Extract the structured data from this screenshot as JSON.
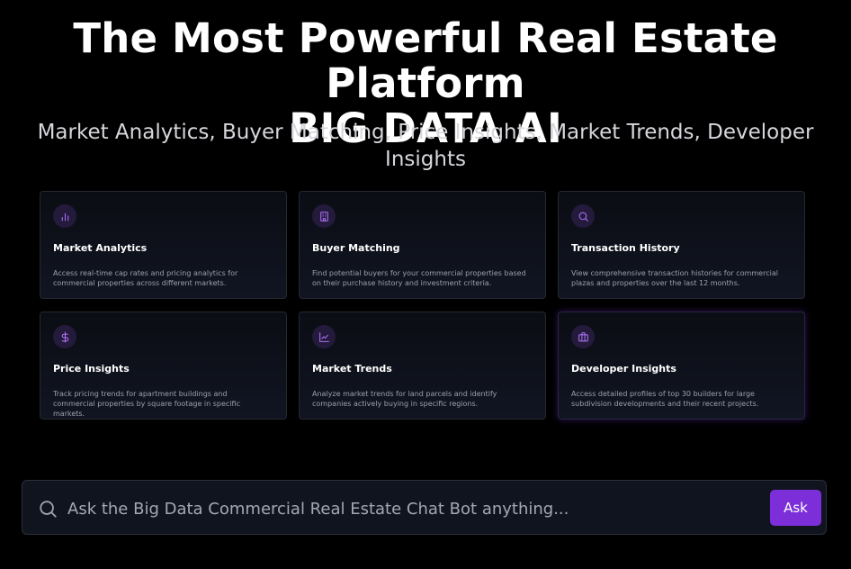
{
  "hero": {
    "title_line1": "The Most Powerful Real Estate Platform",
    "title_line2": "BIG DATA AI",
    "subtitle": "Market Analytics, Buyer Matching, Price Insights, Market Trends, Developer Insights"
  },
  "colors": {
    "accent": "#7c2fd9",
    "icon_bg": "#241a3b",
    "icon_stroke": "#a970f0"
  },
  "cards": [
    {
      "icon": "bar-chart-icon",
      "title": "Market Analytics",
      "desc": "Access real-time cap rates and pricing analytics for commercial properties across different markets."
    },
    {
      "icon": "building-icon",
      "title": "Buyer Matching",
      "desc": "Find potential buyers for your commercial properties based on their purchase history and investment criteria."
    },
    {
      "icon": "search-icon",
      "title": "Transaction History",
      "desc": "View comprehensive transaction histories for commercial plazas and properties over the last 12 months."
    },
    {
      "icon": "dollar-icon",
      "title": "Price Insights",
      "desc": "Track pricing trends for apartment buildings and commercial properties by square footage in specific markets."
    },
    {
      "icon": "line-chart-icon",
      "title": "Market Trends",
      "desc": "Analyze market trends for land parcels and identify companies actively buying in specific regions."
    },
    {
      "icon": "briefcase-icon",
      "title": "Developer Insights",
      "desc": "Access detailed profiles of top 30 builders for large subdivision developments and their recent projects."
    }
  ],
  "chat": {
    "icon": "search-icon",
    "placeholder": "Ask the Big Data Commercial Real Estate Chat Bot anything...",
    "ask_label": "Ask"
  }
}
